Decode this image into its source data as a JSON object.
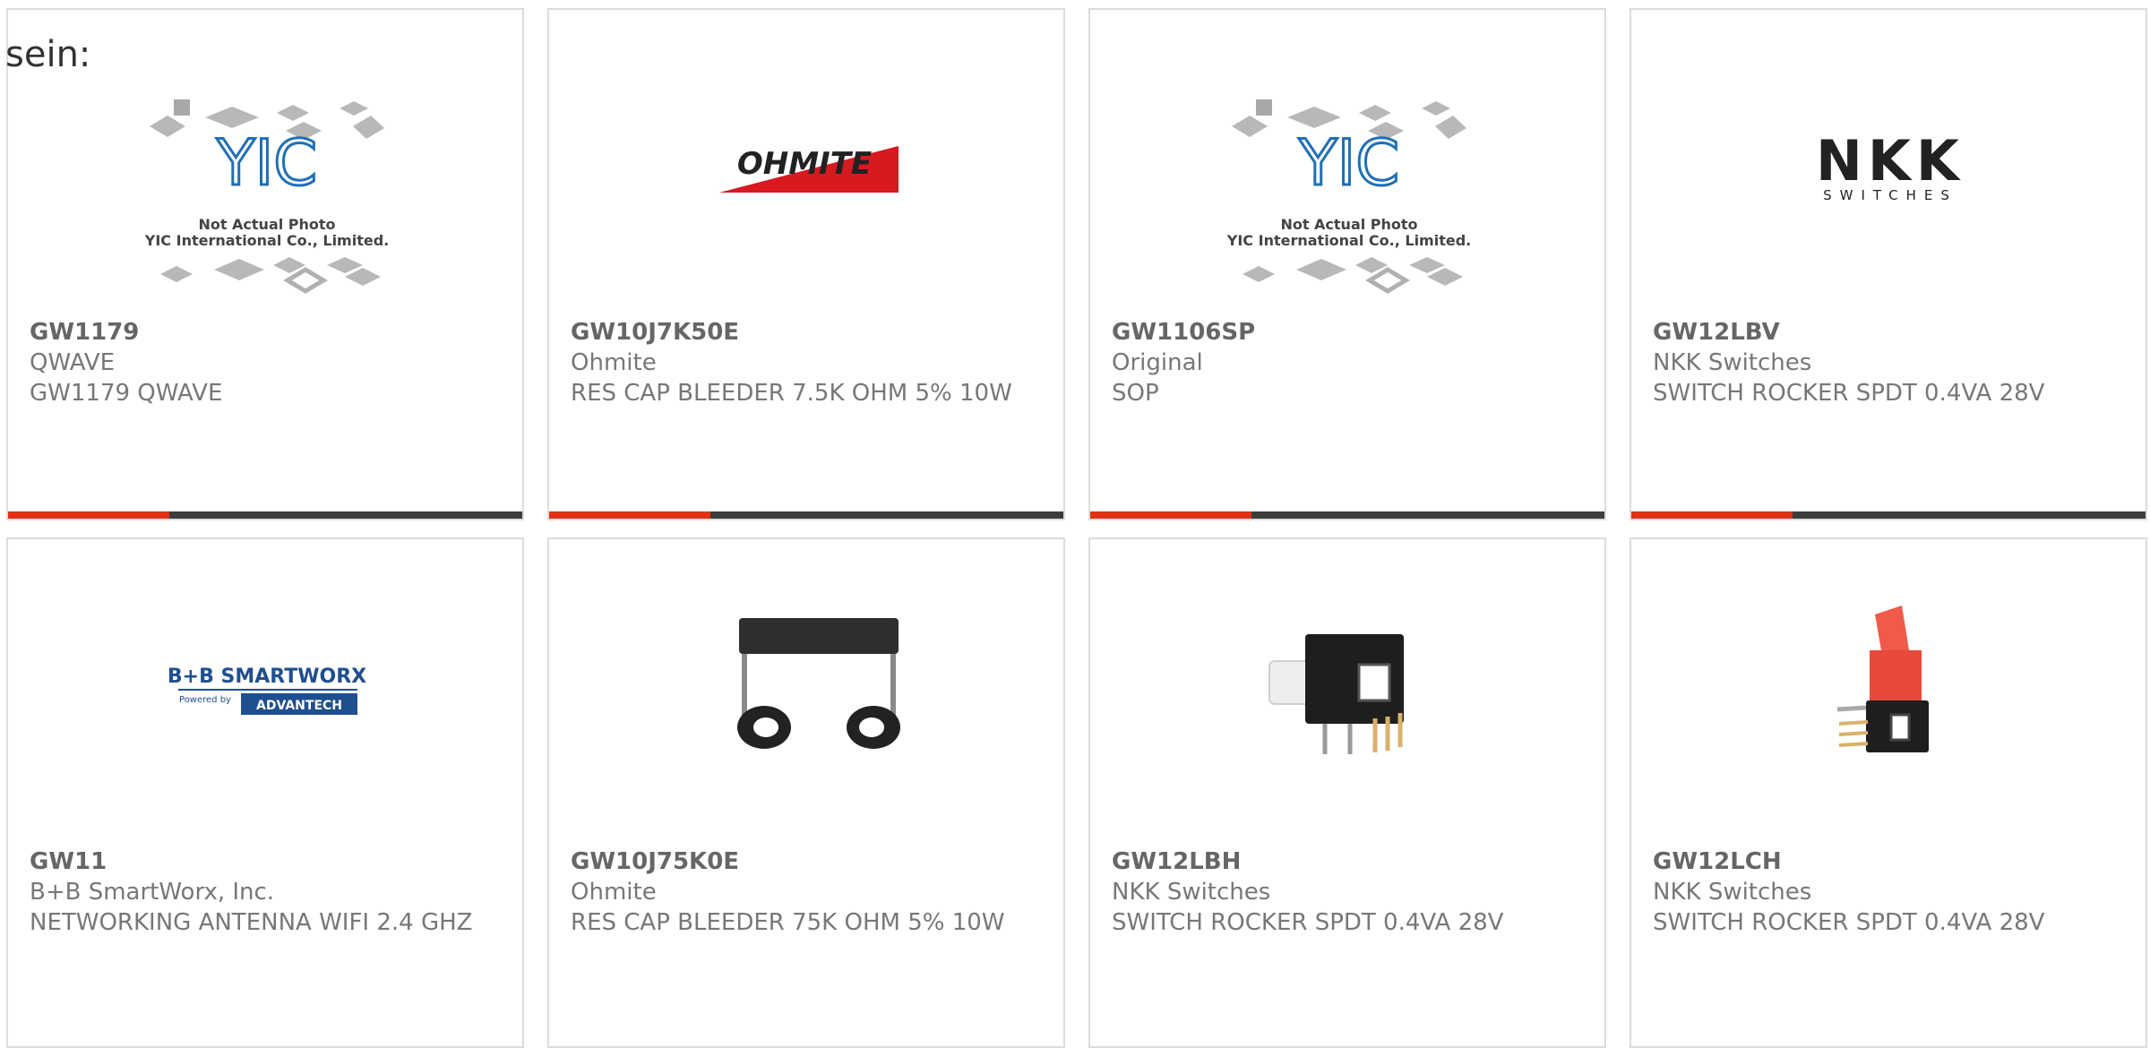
{
  "prefix_text": "sein:",
  "cards": [
    {
      "part": "GW1179",
      "manufacturer": "QWAVE",
      "description": "GW1179 QWAVE",
      "image": "yic-not-actual-photo",
      "logo_text": "YIC",
      "caption_line1": "Not Actual Photo",
      "caption_line2": "YIC International Co., Limited."
    },
    {
      "part": "GW10J7K50E",
      "manufacturer": "Ohmite",
      "description": "RES CAP BLEEDER 7.5K OHM 5% 10W",
      "image": "ohmite-logo",
      "logo_text": "OHMITE"
    },
    {
      "part": "GW1106SP",
      "manufacturer": "Original",
      "description": "SOP",
      "image": "yic-not-actual-photo",
      "logo_text": "YIC",
      "caption_line1": "Not Actual Photo",
      "caption_line2": "YIC International Co., Limited."
    },
    {
      "part": "GW12LBV",
      "manufacturer": "NKK Switches",
      "description": "SWITCH ROCKER SPDT 0.4VA 28V",
      "image": "nkk-logo",
      "logo_text": "NKK",
      "logo_sub": "SWITCHES"
    },
    {
      "part": "GW11",
      "manufacturer": "B+B SmartWorx, Inc.",
      "description": "NETWORKING ANTENNA WIFI 2.4 GHZ",
      "image": "bb-smartworx-logo",
      "logo_text": "B+B SMARTWORX",
      "logo_sub1": "Powered by",
      "logo_sub2": "ADVANTECH"
    },
    {
      "part": "GW10J75K0E",
      "manufacturer": "Ohmite",
      "description": "RES CAP BLEEDER 75K OHM 5% 10W",
      "image": "bleeder-resistor-photo"
    },
    {
      "part": "GW12LBH",
      "manufacturer": "NKK Switches",
      "description": "SWITCH ROCKER SPDT 0.4VA 28V",
      "image": "rocker-switch-horizontal-photo"
    },
    {
      "part": "GW12LCH",
      "manufacturer": "NKK Switches",
      "description": "SWITCH ROCKER SPDT 0.4VA 28V",
      "image": "rocker-switch-red-photo"
    }
  ],
  "colors": {
    "accent_red": "#e03214",
    "bar_dark": "#3d3d3d",
    "card_border": "#dcdcdc",
    "text": "#666666"
  }
}
